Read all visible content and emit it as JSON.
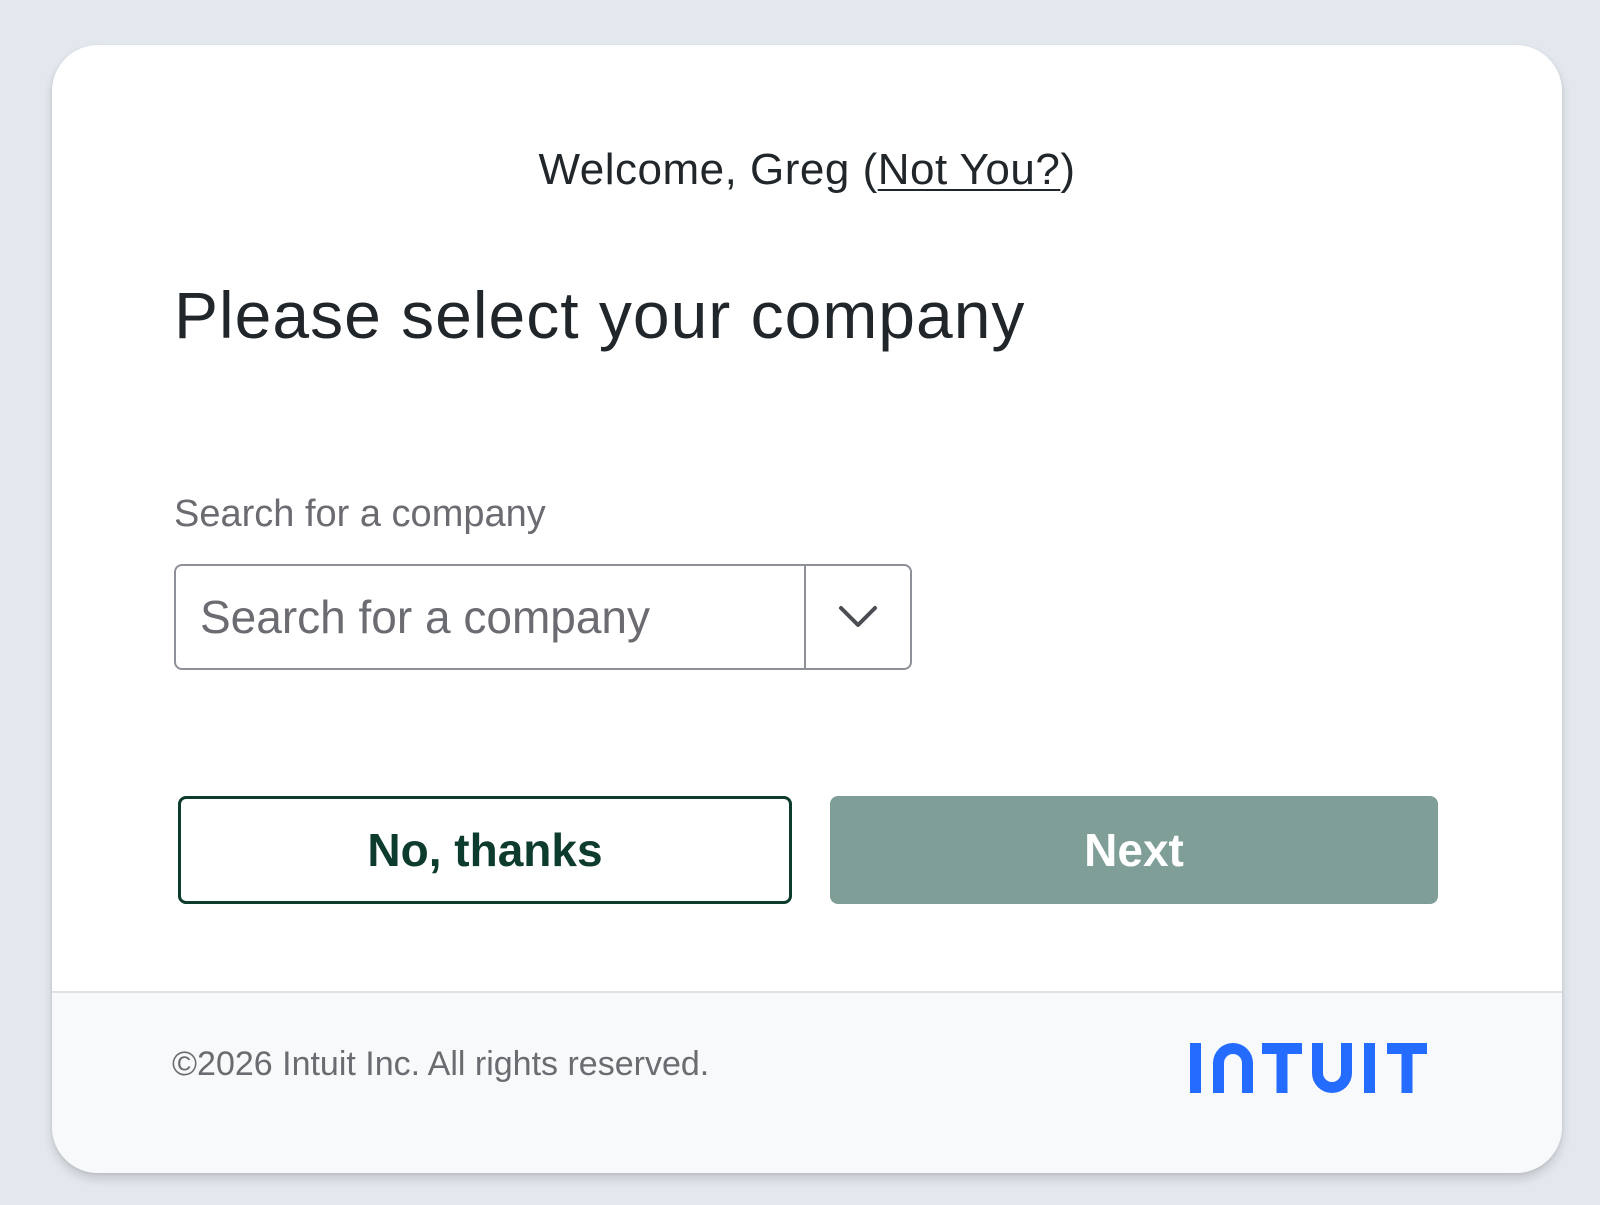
{
  "header": {
    "welcome_prefix": "Welcome, Greg (",
    "not_you_link": "Not You?",
    "welcome_suffix": ")"
  },
  "main": {
    "heading": "Please select your company",
    "search_label": "Search for a company",
    "search_placeholder": "Search for a company",
    "search_value": "",
    "dropdown_icon": "chevron-down-icon"
  },
  "actions": {
    "no_thanks_label": "No, thanks",
    "next_label": "Next",
    "next_enabled": false
  },
  "footer": {
    "copyright": "©2026 Intuit Inc. All rights reserved.",
    "logo_text": "INTUIT"
  },
  "colors": {
    "page_background": "#e3e8ee",
    "text_primary": "#21262a",
    "text_secondary": "#6b6c72",
    "secondary_button_border": "#0d3b2e",
    "primary_button_disabled": "#7f9e97",
    "intuit_blue": "#236cff"
  }
}
